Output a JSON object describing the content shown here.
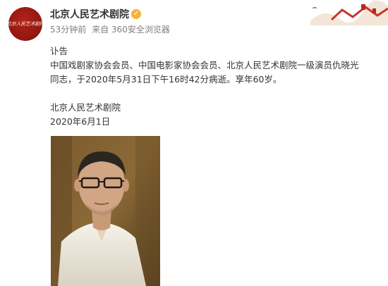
{
  "account": {
    "avatar_text": "北京人民艺术剧院",
    "name": "北京人民艺术剧院",
    "verified": true
  },
  "meta": {
    "time": "53分钟前",
    "source": "来自 360安全浏览器"
  },
  "post": {
    "title": "讣告",
    "line1": "中国戏剧家协会会员、中国电影家协会会员、北京人民艺术剧院一级演员仇晓光",
    "line2": "同志，于2020年5月31日下午16时42分病逝。享年60岁。",
    "signature": "北京人民艺术剧院",
    "date": "2020年6月1日"
  },
  "colors": {
    "avatar": "#9e1b14",
    "verified_badge": "#f5b43a",
    "meta_text": "#808080"
  }
}
